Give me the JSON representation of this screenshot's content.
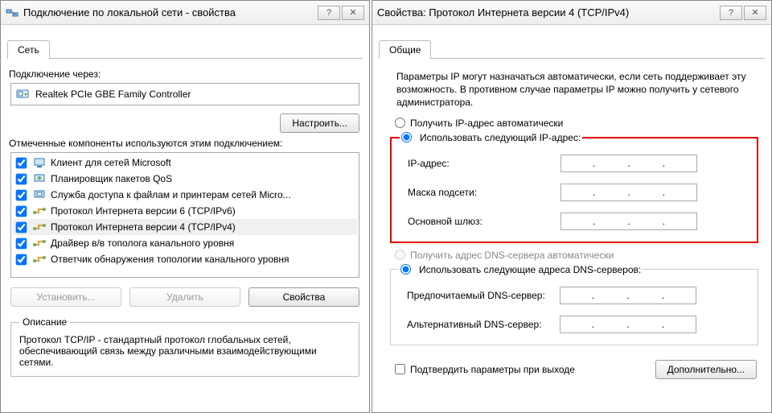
{
  "left": {
    "title": "Подключение по локальной сети - свойства",
    "tab": "Сеть",
    "connect_via_label": "Подключение через:",
    "adapter": "Realtek PCIe GBE Family Controller",
    "configure_btn": "Настроить...",
    "components_label": "Отмеченные компоненты используются этим подключением:",
    "items": [
      {
        "label": "Клиент для сетей Microsoft",
        "icon": "client-icon"
      },
      {
        "label": "Планировщик пакетов QoS",
        "icon": "qos-icon"
      },
      {
        "label": "Служба доступа к файлам и принтерам сетей Micro...",
        "icon": "fileshare-icon"
      },
      {
        "label": "Протокол Интернета версии 6 (TCP/IPv6)",
        "icon": "protocol-icon"
      },
      {
        "label": "Протокол Интернета версии 4 (TCP/IPv4)",
        "icon": "protocol-icon",
        "selected": true
      },
      {
        "label": "Драйвер в/в тополога канального уровня",
        "icon": "protocol-icon"
      },
      {
        "label": "Ответчик обнаружения топологии канального уровня",
        "icon": "protocol-icon"
      }
    ],
    "install_btn": "Установить...",
    "uninstall_btn": "Удалить",
    "properties_btn": "Свойства",
    "desc_title": "Описание",
    "desc_text": "Протокол TCP/IP - стандартный протокол глобальных сетей, обеспечивающий связь между различными взаимодействующими сетями."
  },
  "right": {
    "title": "Свойства: Протокол Интернета версии 4 (TCP/IPv4)",
    "tab": "Общие",
    "intro": "Параметры IP могут назначаться автоматически, если сеть поддерживает эту возможность. В противном случае параметры IP можно получить у сетевого администратора.",
    "ip_auto": "Получить IP-адрес автоматически",
    "ip_manual": "Использовать следующий IP-адрес:",
    "ip_label": "IP-адрес:",
    "mask_label": "Маска подсети:",
    "gateway_label": "Основной шлюз:",
    "dns_auto": "Получить адрес DNS-сервера автоматически",
    "dns_manual": "Использовать следующие адреса DNS-серверов:",
    "dns_pref": "Предпочитаемый DNS-сервер:",
    "dns_alt": "Альтернативный DNS-сервер:",
    "confirm_exit": "Подтвердить параметры при выходе",
    "advanced_btn": "Дополнительно..."
  },
  "dot": "."
}
